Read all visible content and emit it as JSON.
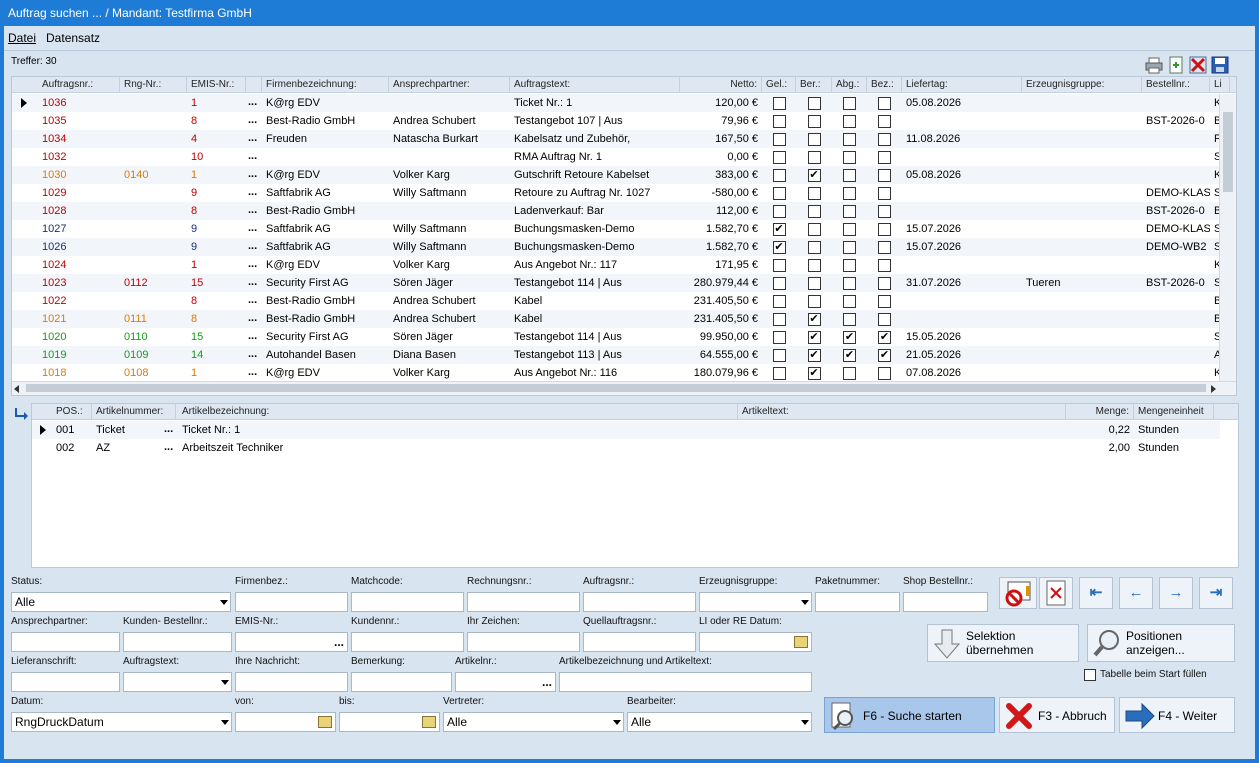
{
  "window": {
    "title": "Auftrag suchen ... / Mandant: Testfirma GmbH"
  },
  "menu": {
    "file": "Datei",
    "dataset": "Datensatz"
  },
  "hits": "Treffer: 30",
  "orders": {
    "headers": [
      "Auftragsnr.:",
      "Rng-Nr.:",
      "EMIS-Nr.:",
      "Firmenbezeichnung:",
      "Ansprechpartner:",
      "Auftragstext:",
      "Netto:",
      "Gel.:",
      "Ber.:",
      "Abg.:",
      "Bez.:",
      "Liefertag:",
      "Erzeugnisgruppe:",
      "Bestellnr.:",
      "Li"
    ],
    "rows": [
      {
        "nr": "1036",
        "rng": "",
        "emis": "1",
        "firma": "K@rg EDV",
        "ansp": "",
        "text": "Ticket Nr.: 1",
        "netto": "120,00 €",
        "gel": false,
        "ber": false,
        "abg": false,
        "bez": false,
        "liefer": "05.08.2026",
        "gruppe": "",
        "best": "",
        "li": "K",
        "color": "#c00000"
      },
      {
        "nr": "1035",
        "rng": "",
        "emis": "8",
        "firma": "Best-Radio GmbH",
        "ansp": "Andrea Schubert",
        "text": "Testangebot 107 | Aus",
        "netto": "79,96 €",
        "gel": false,
        "ber": false,
        "abg": false,
        "bez": false,
        "liefer": "",
        "gruppe": "",
        "best": "BST-2026-0",
        "li": "B",
        "color": "#c00000"
      },
      {
        "nr": "1034",
        "rng": "",
        "emis": "4",
        "firma": "Freuden",
        "ansp": "Natascha Burkart",
        "text": "Kabelsatz und Zubehör,",
        "netto": "167,50 €",
        "gel": false,
        "ber": false,
        "abg": false,
        "bez": false,
        "liefer": "11.08.2026",
        "gruppe": "",
        "best": "",
        "li": "Fr",
        "color": "#c00000"
      },
      {
        "nr": "1032",
        "rng": "",
        "emis": "10",
        "firma": "",
        "ansp": "",
        "text": "RMA Auftrag Nr. 1",
        "netto": "0,00 €",
        "gel": false,
        "ber": false,
        "abg": false,
        "bez": false,
        "liefer": "",
        "gruppe": "",
        "best": "",
        "li": "Sp",
        "color": "#c00000"
      },
      {
        "nr": "1030",
        "rng": "0140",
        "emis": "1",
        "firma": "K@rg EDV",
        "ansp": "Volker Karg",
        "text": "Gutschrift Retoure Kabelset",
        "netto": "383,00 €",
        "gel": false,
        "ber": true,
        "abg": false,
        "bez": false,
        "liefer": "05.08.2026",
        "gruppe": "",
        "best": "",
        "li": "K",
        "color": "#e07a00"
      },
      {
        "nr": "1029",
        "rng": "",
        "emis": "9",
        "firma": "Saftfabrik AG",
        "ansp": "Willy Saftmann",
        "text": "Retoure zu Auftrag Nr. 1027",
        "netto": "-580,00 €",
        "gel": false,
        "ber": false,
        "abg": false,
        "bez": false,
        "liefer": "",
        "gruppe": "",
        "best": "DEMO-KLAS",
        "li": "Sa",
        "color": "#c00000"
      },
      {
        "nr": "1028",
        "rng": "",
        "emis": "8",
        "firma": "Best-Radio GmbH",
        "ansp": "",
        "text": "Ladenverkauf: Bar",
        "netto": "112,00 €",
        "gel": false,
        "ber": false,
        "abg": false,
        "bez": false,
        "liefer": "",
        "gruppe": "",
        "best": "BST-2026-0",
        "li": "B",
        "color": "#c00000"
      },
      {
        "nr": "1027",
        "rng": "",
        "emis": "9",
        "firma": "Saftfabrik AG",
        "ansp": "Willy Saftmann",
        "text": "Buchungsmasken-Demo",
        "netto": "1.582,70 €",
        "gel": true,
        "ber": false,
        "abg": false,
        "bez": false,
        "liefer": "15.07.2026",
        "gruppe": "",
        "best": "DEMO-KLAS",
        "li": "Sa",
        "color": "#1a2f7a"
      },
      {
        "nr": "1026",
        "rng": "",
        "emis": "9",
        "firma": "Saftfabrik AG",
        "ansp": "Willy Saftmann",
        "text": "Buchungsmasken-Demo",
        "netto": "1.582,70 €",
        "gel": true,
        "ber": false,
        "abg": false,
        "bez": false,
        "liefer": "15.07.2026",
        "gruppe": "",
        "best": "DEMO-WB2",
        "li": "Sa",
        "color": "#1a2f7a"
      },
      {
        "nr": "1024",
        "rng": "",
        "emis": "1",
        "firma": "K@rg EDV",
        "ansp": "Volker Karg",
        "text": "Aus Angebot Nr.: 117",
        "netto": "171,95 €",
        "gel": false,
        "ber": false,
        "abg": false,
        "bez": false,
        "liefer": "",
        "gruppe": "",
        "best": "",
        "li": "K",
        "color": "#c00000"
      },
      {
        "nr": "1023",
        "rng": "0112",
        "emis": "15",
        "firma": "Security First AG",
        "ansp": "Sören Jäger",
        "text": "Testangebot 114 | Aus",
        "netto": "280.979,44 €",
        "gel": false,
        "ber": false,
        "abg": false,
        "bez": false,
        "liefer": "31.07.2026",
        "gruppe": "Tueren",
        "best": "BST-2026-0",
        "li": "Se",
        "color": "#c00000"
      },
      {
        "nr": "1022",
        "rng": "",
        "emis": "8",
        "firma": "Best-Radio GmbH",
        "ansp": "Andrea Schubert",
        "text": "Kabel",
        "netto": "231.405,50 €",
        "gel": false,
        "ber": false,
        "abg": false,
        "bez": false,
        "liefer": "",
        "gruppe": "",
        "best": "",
        "li": "B",
        "color": "#c00000"
      },
      {
        "nr": "1021",
        "rng": "0111",
        "emis": "8",
        "firma": "Best-Radio GmbH",
        "ansp": "Andrea Schubert",
        "text": "Kabel",
        "netto": "231.405,50 €",
        "gel": false,
        "ber": true,
        "abg": false,
        "bez": false,
        "liefer": "",
        "gruppe": "",
        "best": "",
        "li": "B",
        "color": "#e07a00"
      },
      {
        "nr": "1020",
        "rng": "0110",
        "emis": "15",
        "firma": "Security First AG",
        "ansp": "Sören Jäger",
        "text": "Testangebot 114 | Aus",
        "netto": "99.950,00 €",
        "gel": false,
        "ber": true,
        "abg": true,
        "bez": true,
        "liefer": "15.05.2026",
        "gruppe": "",
        "best": "",
        "li": "Se",
        "color": "#1a9a1a"
      },
      {
        "nr": "1019",
        "rng": "0109",
        "emis": "14",
        "firma": "Autohandel Basen",
        "ansp": "Diana Basen",
        "text": "Testangebot 113 | Aus",
        "netto": "64.555,00 €",
        "gel": false,
        "ber": true,
        "abg": true,
        "bez": true,
        "liefer": "21.05.2026",
        "gruppe": "",
        "best": "",
        "li": "A",
        "color": "#1a9a1a"
      },
      {
        "nr": "1018",
        "rng": "0108",
        "emis": "1",
        "firma": "K@rg EDV",
        "ansp": "Volker Karg",
        "text": "Aus Angebot Nr.: 116",
        "netto": "180.079,96 €",
        "gel": false,
        "ber": true,
        "abg": false,
        "bez": false,
        "liefer": "07.08.2026",
        "gruppe": "",
        "best": "",
        "li": "K",
        "color": "#e07a00"
      }
    ]
  },
  "positions": {
    "headers": [
      "POS.:",
      "Artikelnummer:",
      "Artikelbezeichnung:",
      "Artikeltext:",
      "Menge:",
      "Mengeneinheit"
    ],
    "rows": [
      {
        "pos": "001",
        "art": "Ticket",
        "bez": "Ticket Nr.: 1",
        "text": "",
        "menge": "0,22",
        "einheit": "Stunden"
      },
      {
        "pos": "002",
        "art": "AZ",
        "bez": "Arbeitszeit Techniker",
        "text": "",
        "menge": "2,00",
        "einheit": "Stunden"
      }
    ]
  },
  "filters": {
    "status_label": "Status:",
    "status_value": "Alle",
    "firmenbez": "Firmenbez.:",
    "matchcode": "Matchcode:",
    "rechnungsnr": "Rechnungsnr.:",
    "auftragsnr": "Auftragsnr.:",
    "erzeugnisgruppe": "Erzeugnisgruppe:",
    "paketnummer": "Paketnummer:",
    "shop": "Shop Bestellnr.:",
    "ansprechpartner": "Ansprechpartner:",
    "kundenbestell": "Kunden- Bestellnr.:",
    "emis": "EMIS-Nr.:",
    "kundennr": "Kundennr.:",
    "ihrzeichen": "Ihr Zeichen:",
    "quellauftrag": "Quellauftragsnr.:",
    "lidatum": "LI oder RE Datum:",
    "lieferanschrift": "Lieferanschrift:",
    "auftragstext": "Auftragstext:",
    "ihrenachricht": "Ihre Nachricht:",
    "bemerkung": "Bemerkung:",
    "artikelnr": "Artikelnr.:",
    "artbez": "Artikelbezeichnung und Artikeltext:",
    "datum_label": "Datum:",
    "datum_value": "RngDruckDatum",
    "von": "von:",
    "bis": "bis:",
    "vertreter_label": "Vertreter:",
    "vertreter_value": "Alle",
    "bearbeiter_label": "Bearbeiter:",
    "bearbeiter_value": "Alle"
  },
  "buttons": {
    "selektion": "Selektion übernehmen",
    "positionen": "Positionen anzeigen...",
    "tabelle": "Tabelle beim Start füllen",
    "suche": "F6 - Suche starten",
    "abbruch": "F3 - Abbruch",
    "weiter": "F4 - Weiter"
  }
}
